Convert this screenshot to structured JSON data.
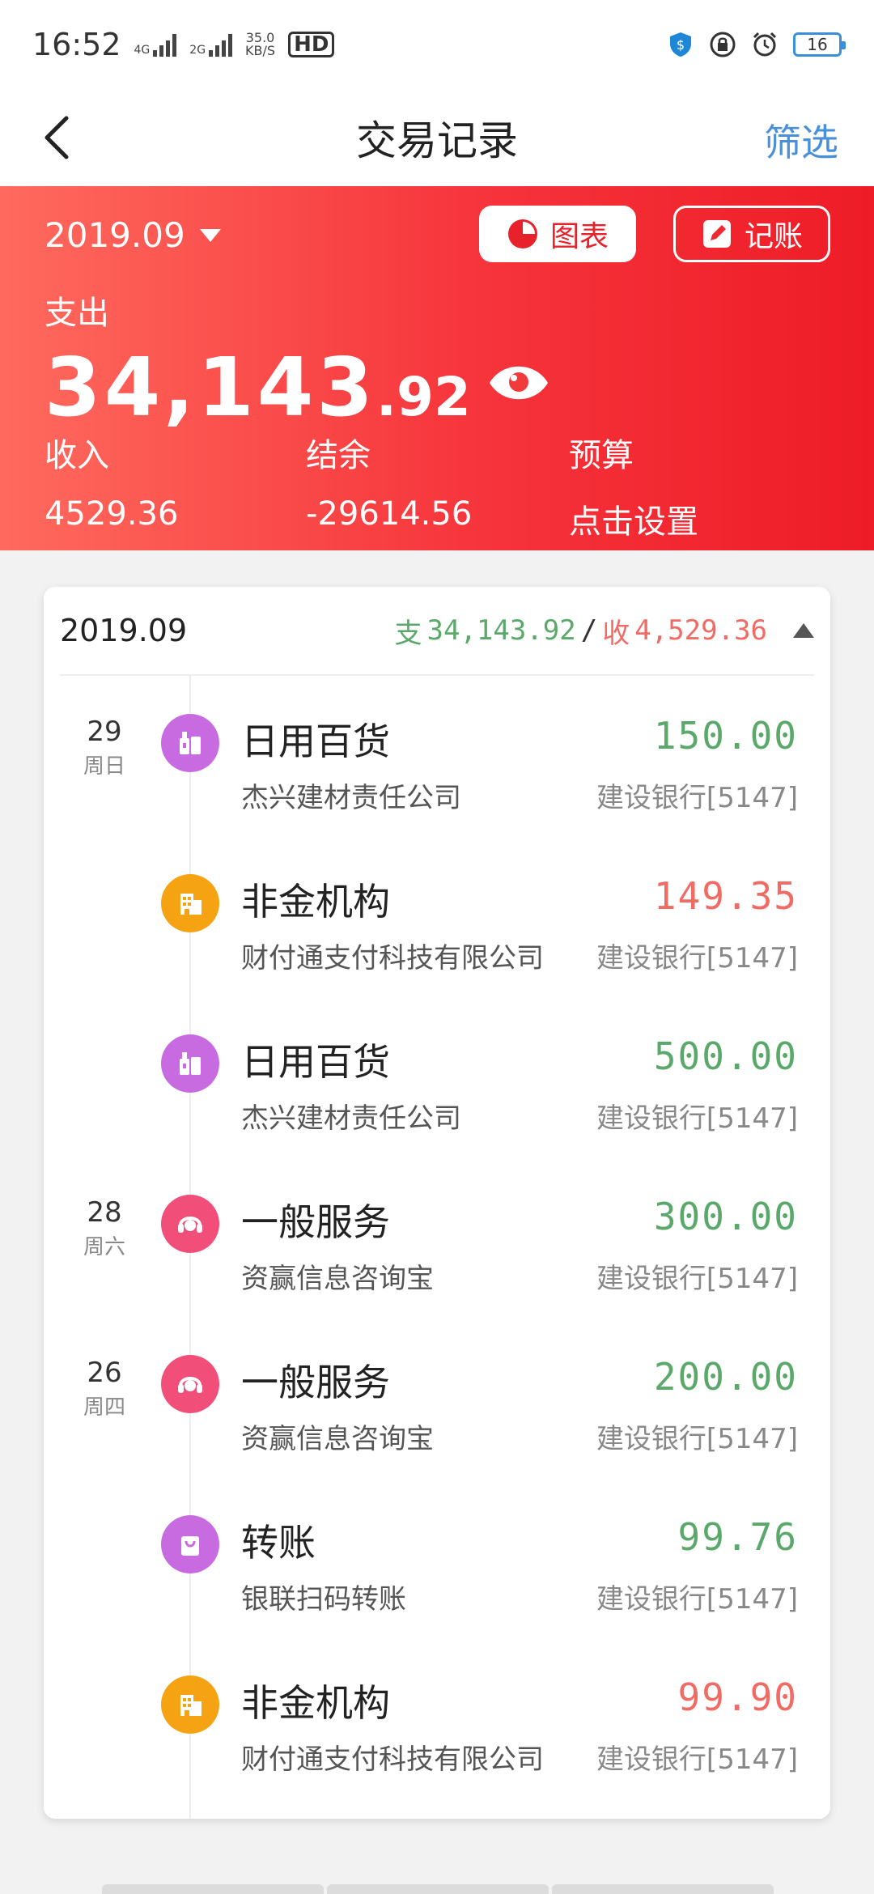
{
  "status_bar": {
    "time": "16:52",
    "net1": "4G",
    "net2": "2G",
    "speed_value": "35.0",
    "speed_unit": "KB/S",
    "hd": "HD",
    "battery": "16"
  },
  "header": {
    "title": "交易记录",
    "filter_label": "筛选"
  },
  "hero": {
    "month": "2019.09",
    "chart_button": "图表",
    "note_button": "记账",
    "expense_label": "支出",
    "expense_int": "34,143",
    "expense_dec": ".92",
    "income_label": "收入",
    "income_value": "4529.36",
    "balance_label": "结余",
    "balance_value": "-29614.56",
    "budget_label": "预算",
    "budget_value": "点击设置"
  },
  "card": {
    "month": "2019.09",
    "expense_prefix": "支",
    "expense_total": "34,143.92",
    "separator": "/",
    "income_prefix": "收",
    "income_total": "4,529.36"
  },
  "colors": {
    "accent_blue": "#4a90d9",
    "hero_red": "#ee1c27",
    "amount_green": "#5aa96a",
    "amount_red": "#f06b64",
    "icon_purple": "#c86be0",
    "icon_orange": "#f5a313",
    "icon_pink": "#f24e7a"
  },
  "transactions": [
    {
      "day": "29",
      "weekday": "周日",
      "category": "日用百货",
      "merchant": "杰兴建材责任公司",
      "amount": "150.00",
      "bank": "建设银行[5147]",
      "icon": "shopping-bottles-icon",
      "icon_color": "#c86be0",
      "amount_color": "green"
    },
    {
      "day": "",
      "weekday": "",
      "category": "非金机构",
      "merchant": "财付通支付科技有限公司",
      "amount": "149.35",
      "bank": "建设银行[5147]",
      "icon": "building-icon",
      "icon_color": "#f5a313",
      "amount_color": "red"
    },
    {
      "day": "",
      "weekday": "",
      "category": "日用百货",
      "merchant": "杰兴建材责任公司",
      "amount": "500.00",
      "bank": "建设银行[5147]",
      "icon": "shopping-bottles-icon",
      "icon_color": "#c86be0",
      "amount_color": "green"
    },
    {
      "day": "28",
      "weekday": "周六",
      "category": "一般服务",
      "merchant": "资赢信息咨询宝",
      "amount": "300.00",
      "bank": "建设银行[5147]",
      "icon": "headset-icon",
      "icon_color": "#f24e7a",
      "amount_color": "green"
    },
    {
      "day": "26",
      "weekday": "周四",
      "category": "一般服务",
      "merchant": "资赢信息咨询宝",
      "amount": "200.00",
      "bank": "建设银行[5147]",
      "icon": "headset-icon",
      "icon_color": "#f24e7a",
      "amount_color": "green"
    },
    {
      "day": "",
      "weekday": "",
      "category": "转账",
      "merchant": "银联扫码转账",
      "amount": "99.76",
      "bank": "建设银行[5147]",
      "icon": "shopping-bag-icon",
      "icon_color": "#c86be0",
      "amount_color": "green"
    },
    {
      "day": "",
      "weekday": "",
      "category": "非金机构",
      "merchant": "财付通支付科技有限公司",
      "amount": "99.90",
      "bank": "建设银行[5147]",
      "icon": "building-icon",
      "icon_color": "#f5a313",
      "amount_color": "red"
    }
  ]
}
